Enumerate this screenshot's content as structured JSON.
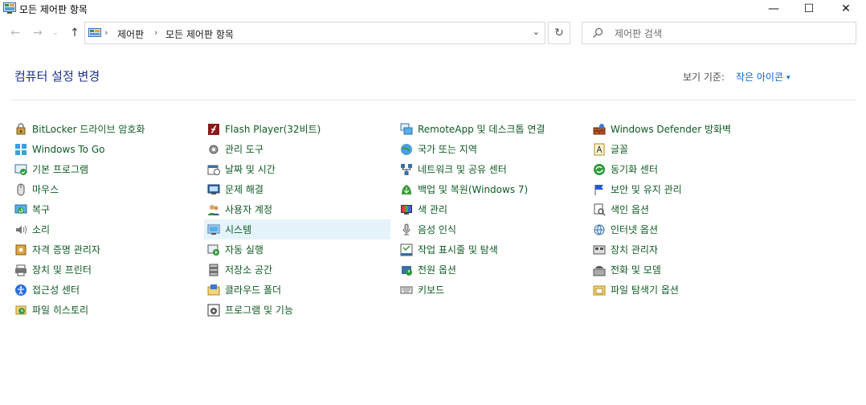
{
  "window": {
    "title": "모든 제어판 항목",
    "buttons": {
      "minimize": "—",
      "maximize": "☐",
      "close": "✕"
    }
  },
  "nav": {
    "back_glyph": "←",
    "forward_glyph": "→",
    "history_glyph": "⌄",
    "up_glyph": "↑",
    "breadcrumbs": [
      "제어판",
      "모든 제어판 항목"
    ],
    "crumb_sep": "›",
    "address_dropdown_glyph": "⌄",
    "refresh_glyph": "↻"
  },
  "search": {
    "placeholder": "제어판 검색",
    "value": ""
  },
  "header": {
    "title": "컴퓨터 설정 변경",
    "view_by_label": "보기 기준:",
    "view_by_value": "작은 아이콘",
    "view_by_caret": "▾"
  },
  "columns": [
    [
      {
        "label": "BitLocker 드라이브 암호화",
        "icon": "bitlocker-icon"
      },
      {
        "label": "Windows To Go",
        "icon": "windows-to-go-icon"
      },
      {
        "label": "기본 프로그램",
        "icon": "default-programs-icon"
      },
      {
        "label": "마우스",
        "icon": "mouse-icon"
      },
      {
        "label": "복구",
        "icon": "recovery-icon"
      },
      {
        "label": "소리",
        "icon": "sound-icon"
      },
      {
        "label": "자격 증명 관리자",
        "icon": "credential-manager-icon"
      },
      {
        "label": "장치 및 프린터",
        "icon": "devices-printers-icon"
      },
      {
        "label": "접근성 센터",
        "icon": "ease-of-access-icon"
      },
      {
        "label": "파일 히스토리",
        "icon": "file-history-icon"
      }
    ],
    [
      {
        "label": "Flash Player(32비트)",
        "icon": "flash-player-icon"
      },
      {
        "label": "관리 도구",
        "icon": "admin-tools-icon"
      },
      {
        "label": "날짜 및 시간",
        "icon": "date-time-icon"
      },
      {
        "label": "문제 해결",
        "icon": "troubleshooting-icon"
      },
      {
        "label": "사용자 계정",
        "icon": "user-accounts-icon"
      },
      {
        "label": "시스템",
        "icon": "system-icon",
        "selected": true
      },
      {
        "label": "자동 실행",
        "icon": "autoplay-icon"
      },
      {
        "label": "저장소 공간",
        "icon": "storage-spaces-icon"
      },
      {
        "label": "클라우드 폴더",
        "icon": "work-folders-icon"
      },
      {
        "label": "프로그램 및 기능",
        "icon": "programs-features-icon"
      }
    ],
    [
      {
        "label": "RemoteApp 및 데스크톱 연결",
        "icon": "remoteapp-icon"
      },
      {
        "label": "국가 또는 지역",
        "icon": "region-icon"
      },
      {
        "label": "네트워크 및 공유 센터",
        "icon": "network-sharing-icon"
      },
      {
        "label": "백업 및 복원(Windows 7)",
        "icon": "backup-restore-icon"
      },
      {
        "label": "색 관리",
        "icon": "color-management-icon"
      },
      {
        "label": "음성 인식",
        "icon": "speech-recognition-icon"
      },
      {
        "label": "작업 표시줄 및 탐색",
        "icon": "taskbar-navigation-icon"
      },
      {
        "label": "전원 옵션",
        "icon": "power-options-icon"
      },
      {
        "label": "키보드",
        "icon": "keyboard-icon"
      }
    ],
    [
      {
        "label": "Windows Defender 방화벽",
        "icon": "firewall-icon"
      },
      {
        "label": "글꼴",
        "icon": "fonts-icon"
      },
      {
        "label": "동기화 센터",
        "icon": "sync-center-icon"
      },
      {
        "label": "보안 및 유지 관리",
        "icon": "security-maintenance-icon"
      },
      {
        "label": "색인 옵션",
        "icon": "indexing-options-icon"
      },
      {
        "label": "인터넷 옵션",
        "icon": "internet-options-icon"
      },
      {
        "label": "장치 관리자",
        "icon": "device-manager-icon"
      },
      {
        "label": "전화 및 모뎀",
        "icon": "phone-modem-icon"
      },
      {
        "label": "파일 탐색기 옵션",
        "icon": "file-explorer-options-icon"
      }
    ]
  ],
  "colors": {
    "link": "#0f5a24",
    "title": "#1e3287",
    "accent": "#0066cc",
    "selected_bg": "#e5f3fb"
  }
}
